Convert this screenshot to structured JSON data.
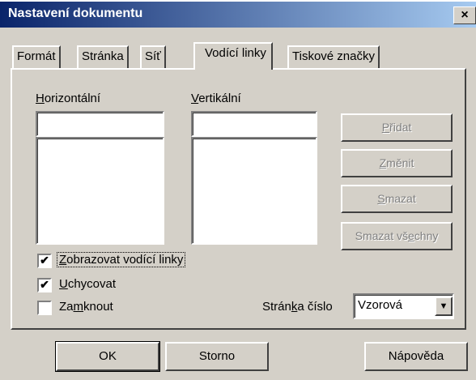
{
  "window": {
    "title": "Nastavení dokumentu",
    "close": "×"
  },
  "tabs": [
    {
      "label": "Formát"
    },
    {
      "label": "Stránka"
    },
    {
      "label": "Síť"
    },
    {
      "label": "Vodící linky",
      "active": true
    },
    {
      "label": "Tiskové značky"
    }
  ],
  "horizontal": {
    "label_u": "H",
    "label_rest": "orizontální",
    "input_value": ""
  },
  "vertical": {
    "label_u": "V",
    "label_rest": "ertikální",
    "input_value": ""
  },
  "side_buttons": {
    "add": {
      "u": "P",
      "rest": "řidat"
    },
    "change": {
      "u": "Z",
      "rest": "měnit"
    },
    "delete": {
      "u": "S",
      "rest": "mazat"
    },
    "delete_all": {
      "pre": "Smazat vš",
      "u": "e",
      "rest": "chny"
    }
  },
  "checkboxes": {
    "show": {
      "u": "Z",
      "rest": "obrazovat vodící linky",
      "checked": "✔"
    },
    "snap": {
      "u": "U",
      "rest": "chycovat",
      "checked": "✔"
    },
    "lock": {
      "pre": "Za",
      "u": "m",
      "rest": "knout",
      "checked": ""
    }
  },
  "page_number": {
    "pre": "Strán",
    "u": "k",
    "rest": "a číslo",
    "value": "Vzorová",
    "arrow": "▼"
  },
  "footer": {
    "ok": "OK",
    "cancel": "Storno",
    "help": "Nápověda"
  }
}
